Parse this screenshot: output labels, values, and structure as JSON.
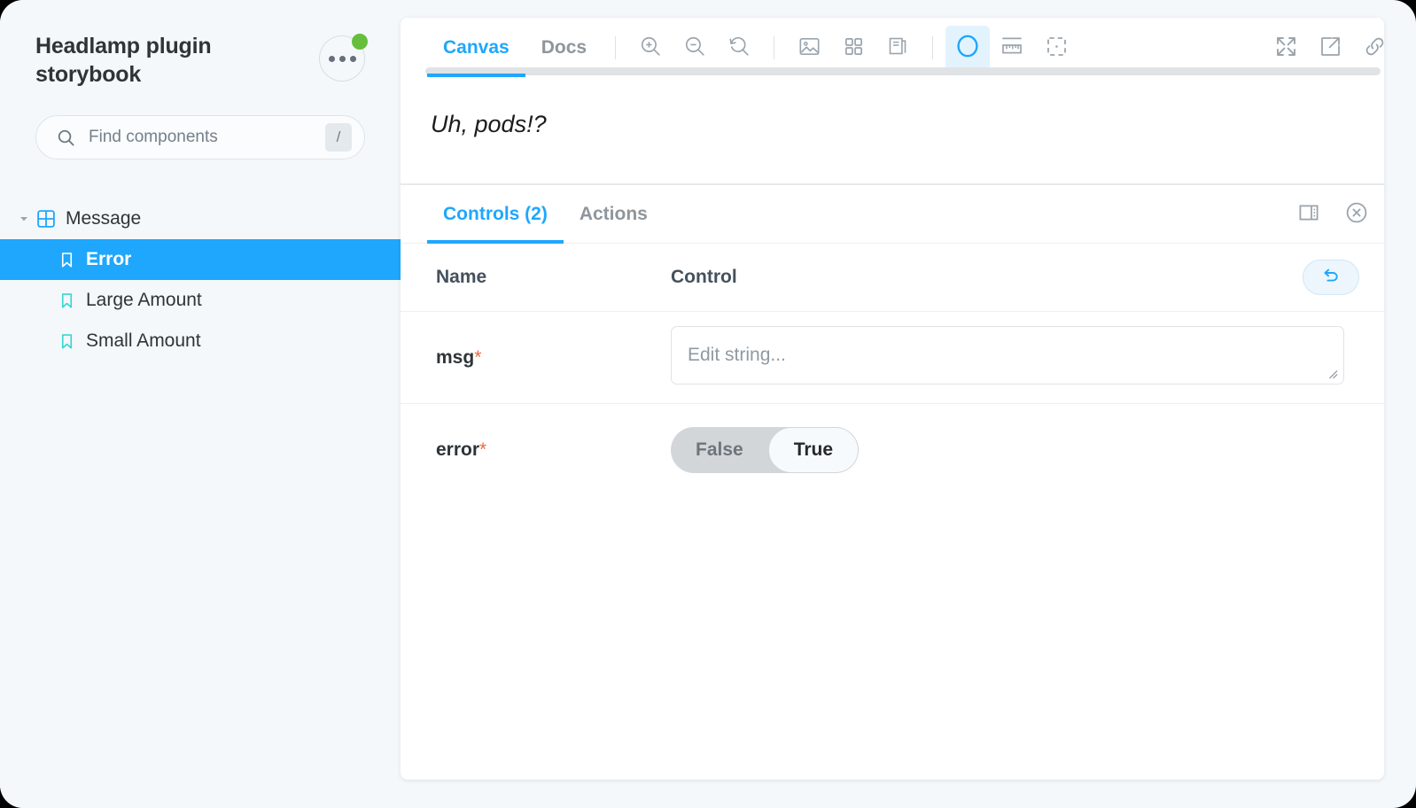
{
  "app": {
    "title": "Headlamp plugin storybook",
    "menu_icon": "ellipsis-icon",
    "notification_dot_color": "#66BF3C"
  },
  "search": {
    "placeholder": "Find components",
    "value": "",
    "icon": "search-icon",
    "shortcut": "/"
  },
  "sidebar": {
    "tree": [
      {
        "label": "Message",
        "type": "component",
        "icon": "component-grid-icon",
        "expanded": true,
        "selected": false
      },
      {
        "label": "Error",
        "type": "story",
        "icon": "bookmark-icon",
        "selected": true
      },
      {
        "label": "Large Amount",
        "type": "story",
        "icon": "bookmark-icon",
        "selected": false
      },
      {
        "label": "Small Amount",
        "type": "story",
        "icon": "bookmark-icon",
        "selected": false
      }
    ]
  },
  "toolbar": {
    "tabs": [
      {
        "label": "Canvas",
        "active": true
      },
      {
        "label": "Docs",
        "active": false
      }
    ],
    "buttons": [
      {
        "name": "zoom-in-icon",
        "active": false
      },
      {
        "name": "zoom-out-icon",
        "active": false
      },
      {
        "name": "zoom-reset-icon",
        "active": false
      },
      {
        "name": "backgrounds-image-icon",
        "active": false
      },
      {
        "name": "grid-icon",
        "active": false
      },
      {
        "name": "viewport-layers-icon",
        "active": false
      },
      {
        "name": "accessibility-circle-icon",
        "active": true
      },
      {
        "name": "measure-ruler-icon",
        "active": false
      },
      {
        "name": "outline-dashed-icon",
        "active": false
      },
      {
        "name": "fullscreen-expand-icon",
        "active": false
      },
      {
        "name": "open-in-new-tab-icon",
        "active": false
      },
      {
        "name": "copy-link-icon",
        "active": false
      }
    ]
  },
  "canvas": {
    "story_message": "Uh, pods!?"
  },
  "addons": {
    "tabs": [
      {
        "label": "Controls (2)",
        "active": true
      },
      {
        "label": "Actions",
        "active": false
      }
    ],
    "panel_buttons": [
      {
        "name": "panel-position-icon"
      },
      {
        "name": "close-panel-icon"
      }
    ],
    "table": {
      "headers": {
        "name": "Name",
        "control": "Control"
      },
      "reset_button": {
        "name": "reset-controls-button",
        "icon": "undo-arrow-icon"
      },
      "rows": [
        {
          "name": "msg",
          "required": true,
          "required_marker": "*",
          "control_type": "string",
          "value": "",
          "placeholder": "Edit string..."
        },
        {
          "name": "error",
          "required": true,
          "required_marker": "*",
          "control_type": "boolean",
          "options": [
            "False",
            "True"
          ],
          "value": "True"
        }
      ]
    }
  },
  "colors": {
    "brand_blue": "#1EA7FD",
    "required_orange": "#F1683A",
    "page_bg": "#F4F8FB",
    "panel_bg": "#FFFFFF",
    "green_dot": "#66BF3C"
  }
}
